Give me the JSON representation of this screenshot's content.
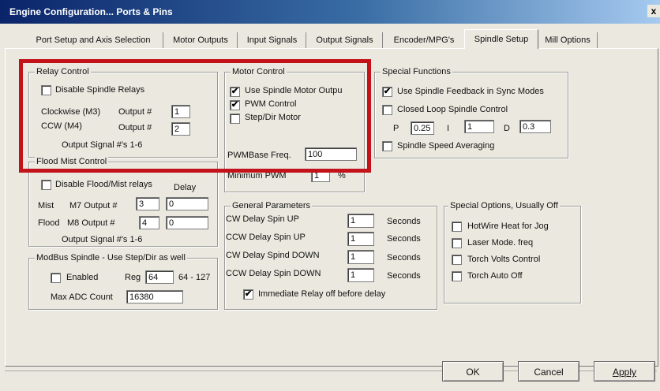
{
  "window": {
    "title": "Engine Configuration... Ports & Pins",
    "close": "x"
  },
  "tabs": [
    "Port Setup and Axis Selection",
    "Motor Outputs",
    "Input Signals",
    "Output Signals",
    "Encoder/MPG's",
    "Spindle Setup",
    "Mill Options"
  ],
  "active_tab": "Spindle Setup",
  "relay_control": {
    "legend": "Relay Control",
    "disable_label": "Disable Spindle Relays",
    "disable_checked": false,
    "cw_label": "Clockwise (M3)",
    "cw_output_label": "Output #",
    "cw_value": "1",
    "ccw_label": "CCW (M4)",
    "ccw_output_label": "Output #",
    "ccw_value": "2",
    "footer": "Output Signal #'s 1-6"
  },
  "flood_mist": {
    "legend": "Flood Mist Control",
    "disable_label": "Disable Flood/Mist relays",
    "disable_checked": false,
    "delay_label": "Delay",
    "mist_label": "Mist",
    "mist_output_label": "M7 Output #",
    "mist_output": "3",
    "mist_delay": "0",
    "flood_label": "Flood",
    "flood_output_label": "M8 Output #",
    "flood_output": "4",
    "flood_delay": "0",
    "footer": "Output Signal #'s 1-6"
  },
  "modbus": {
    "legend": "ModBus Spindle - Use Step/Dir as well",
    "enabled_label": "Enabled",
    "enabled_checked": false,
    "reg_label": "Reg",
    "reg_value": "64",
    "range_label": "64 - 127",
    "max_adc_label": "Max ADC Count",
    "max_adc_value": "16380"
  },
  "motor_control": {
    "legend": "Motor Control",
    "use_spindle_label": "Use Spindle Motor Outpu",
    "use_spindle_checked": "✔",
    "pwm_label": "PWM Control",
    "pwm_checked": "✔",
    "stepdir_label": "Step/Dir Motor",
    "stepdir_checked": "",
    "pwm_base_label": "PWMBase Freq.",
    "pwm_base_value": "100",
    "min_pwm_label": "Minimum PWM",
    "min_pwm_value": "1",
    "min_pwm_unit": "%"
  },
  "special_functions": {
    "legend": "Special Functions",
    "feedback_label": "Use Spindle Feedback in Sync Modes",
    "feedback_checked": "✔",
    "closed_loop_label": "Closed Loop Spindle Control",
    "closed_loop_checked": "",
    "p_label": "P",
    "p_value": "0.25",
    "i_label": "I",
    "i_value": "1",
    "d_label": "D",
    "d_value": "0.3",
    "averaging_label": "Spindle Speed Averaging",
    "averaging_checked": ""
  },
  "general": {
    "legend": "General Parameters",
    "rows": [
      {
        "label": "CW Delay Spin UP",
        "value": "1",
        "unit": "Seconds"
      },
      {
        "label": "CCW Delay Spin UP",
        "value": "1",
        "unit": "Seconds"
      },
      {
        "label": "CW Delay Spind DOWN",
        "value": "1",
        "unit": "Seconds"
      },
      {
        "label": "CCW Delay Spin DOWN",
        "value": "1",
        "unit": "Seconds"
      }
    ],
    "immediate_label": "Immediate Relay off before delay",
    "immediate_checked": "✔"
  },
  "special_options": {
    "legend": "Special Options, Usually Off",
    "items": [
      "HotWire Heat for Jog",
      "Laser Mode. freq",
      "Torch Volts Control",
      "Torch Auto Off"
    ]
  },
  "buttons": {
    "ok": "OK",
    "cancel": "Cancel",
    "apply": "Apply"
  },
  "colors": {
    "highlight": "#c3121a",
    "dialog": "#ebe9df"
  }
}
